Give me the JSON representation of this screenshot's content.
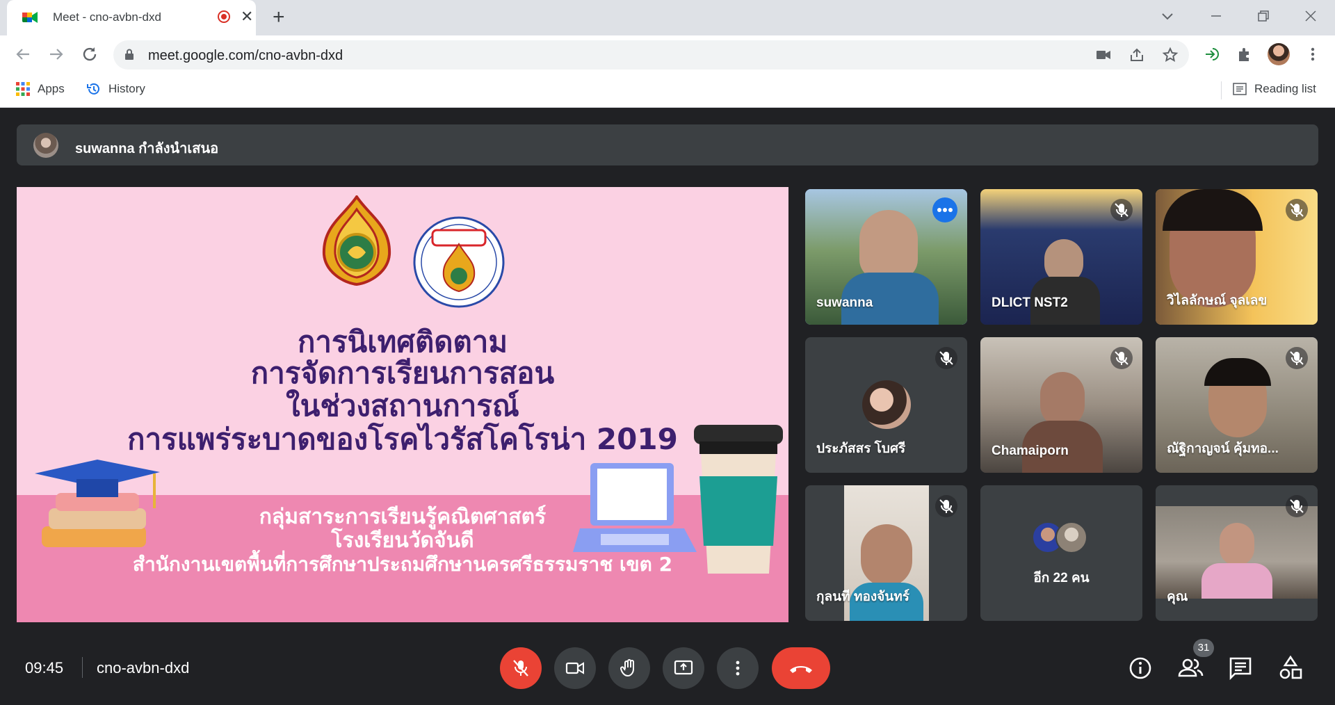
{
  "browser": {
    "tab_title": "Meet - cno-avbn-dxd",
    "url": "meet.google.com/cno-avbn-dxd",
    "bookmarks": {
      "apps": "Apps",
      "history": "History",
      "reading_list": "Reading list"
    }
  },
  "meet": {
    "presenter_banner": "suwanna กำลังนำเสนอ",
    "slide": {
      "title_lines": [
        "การนิเทศติดตาม",
        "การจัดการเรียนการสอน",
        "ในช่วงสถานการณ์",
        "การแพร่ระบาดของโรคไวรัสโคโรน่า 2019"
      ],
      "sub_lines": [
        "กลุ่มสาระการเรียนรู้คณิตศาสตร์",
        "โรงเรียนวัดจันดี",
        "สำนักงานเขตพื้นที่การศึกษาประถมศึกษานครศรีธรรมราช เขต 2"
      ]
    },
    "participants": [
      {
        "name": "suwanna"
      },
      {
        "name": "DLICT NST2"
      },
      {
        "name": "วิไลลักษณ์ จุลเลข"
      },
      {
        "name": "ประภัสสร โบศรี"
      },
      {
        "name": "Chamaiporn"
      },
      {
        "name": "ณัฐิกาญจน์ คุ้มทอ..."
      },
      {
        "name": "กุลนที ทองจันทร์"
      },
      {
        "name": "อีก 22 คน"
      },
      {
        "name": "คุณ"
      }
    ],
    "time": "09:45",
    "meeting_code": "cno-avbn-dxd",
    "people_count": "31"
  }
}
